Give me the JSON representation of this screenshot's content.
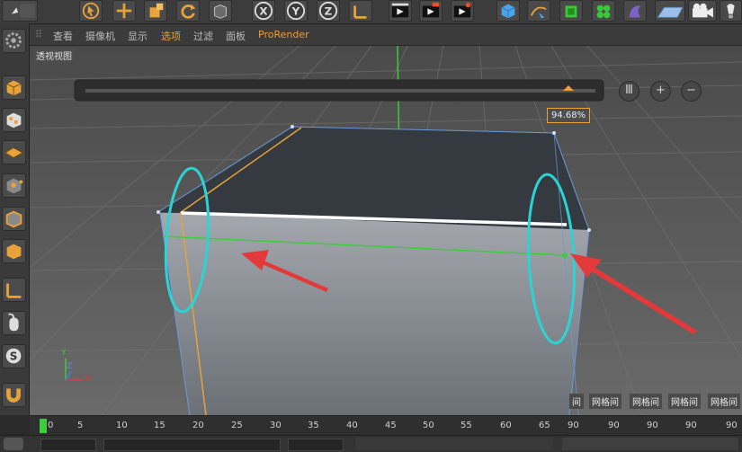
{
  "menu": {
    "items": [
      "查看",
      "摄像机",
      "显示",
      "选项",
      "过滤",
      "面板",
      "ProRender"
    ],
    "active_index": 3
  },
  "viewport": {
    "label": "透视视图",
    "zoom_badge": "94.68%",
    "controls": {
      "menu_icon": "Ⅲ",
      "zoom_in": "+",
      "zoom_out": "−"
    },
    "grid_tags": [
      "间",
      "网格间",
      "网格间",
      "网格间",
      "网格间"
    ],
    "axis_labels": {
      "y": "Y",
      "z": "Z",
      "x": "X"
    }
  },
  "timeline": {
    "ticks": [
      "0",
      "5",
      "10",
      "15",
      "20",
      "25",
      "30",
      "35",
      "40",
      "45",
      "50",
      "55",
      "60",
      "65",
      "90",
      "90",
      "90",
      "90",
      "90"
    ]
  },
  "toolbar": {
    "icons": [
      "undo-icon",
      "select-arrow-icon",
      "move-icon",
      "scale-icon",
      "rotate-icon",
      "object-icon",
      "x-axis-lock-icon",
      "y-axis-lock-icon",
      "z-axis-lock-icon",
      "coordinate-system-icon",
      "render-view-icon",
      "render-picture-viewer-icon",
      "render-settings-icon",
      "cube-primitive-icon",
      "spline-pen-icon",
      "subdivision-icon",
      "mograph-cloner-icon",
      "deformer-icon",
      "floor-icon",
      "camera-icon",
      "light-icon"
    ]
  },
  "colors": {
    "accent_orange": "#e8a23a",
    "selection_green": "#3ccc3c",
    "annotation_cyan": "#2ad4d4",
    "annotation_red": "#e23a3a"
  }
}
